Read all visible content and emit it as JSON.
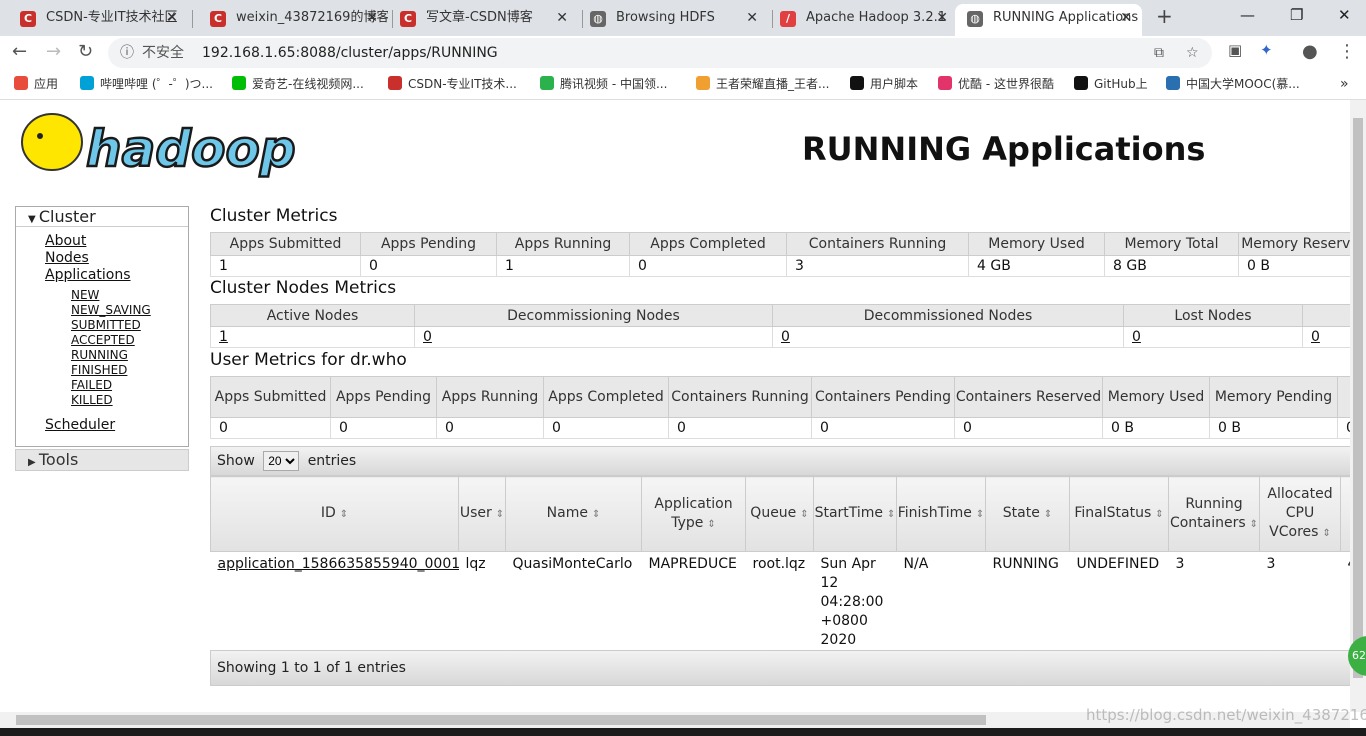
{
  "browser": {
    "tabs": [
      {
        "title": "CSDN-专业IT技术社区",
        "icon": "csdn-icon",
        "color": "#c9302c"
      },
      {
        "title": "weixin_43872169的博客",
        "icon": "csdn-icon",
        "color": "#c9302c"
      },
      {
        "title": "写文章-CSDN博客",
        "icon": "csdn-icon",
        "color": "#c9302c"
      },
      {
        "title": "Browsing HDFS",
        "icon": "globe-icon",
        "color": "#666666"
      },
      {
        "title": "Apache Hadoop 3.2.1",
        "icon": "hadoop-icon",
        "color": "#e04040"
      },
      {
        "title": "RUNNING Applications",
        "icon": "globe-icon",
        "color": "#666666"
      }
    ],
    "insecure_label": "不安全",
    "url": "192.168.1.65:8088/cluster/apps/RUNNING",
    "bookmarks": [
      "应用",
      "哔哩哔哩 (゜-゜)つ...",
      "爱奇艺-在线视频网...",
      "CSDN-专业IT技术...",
      "腾讯视频 - 中国领...",
      "王者荣耀直播_王者...",
      "用户脚本",
      "优酷 - 这世界很酷",
      "GitHub上",
      "中国大学MOOC(慕..."
    ]
  },
  "page": {
    "title": "RUNNING Applications",
    "logo_text": "hadoop",
    "sidebar": {
      "cluster_label": "Cluster",
      "links": [
        "About",
        "Nodes",
        "Applications"
      ],
      "states": [
        "NEW",
        "NEW_SAVING",
        "SUBMITTED",
        "ACCEPTED",
        "RUNNING",
        "FINISHED",
        "FAILED",
        "KILLED"
      ],
      "scheduler": "Scheduler",
      "tools_label": "Tools"
    },
    "cluster_metrics": {
      "title": "Cluster Metrics",
      "headers": [
        "Apps Submitted",
        "Apps Pending",
        "Apps Running",
        "Apps Completed",
        "Containers Running",
        "Memory Used",
        "Memory Total",
        "Memory Reserved"
      ],
      "values": [
        "1",
        "0",
        "1",
        "0",
        "3",
        "4 GB",
        "8 GB",
        "0 B"
      ]
    },
    "cluster_nodes_metrics": {
      "title": "Cluster Nodes Metrics",
      "headers": [
        "Active Nodes",
        "Decommissioning Nodes",
        "Decommissioned Nodes",
        "Lost Nodes",
        ""
      ],
      "values": [
        "1",
        "0",
        "0",
        "0",
        "0"
      ]
    },
    "user_metrics": {
      "title": "User Metrics for dr.who",
      "headers": [
        "Apps Submitted",
        "Apps Pending",
        "Apps Running",
        "Apps Completed",
        "Containers Running",
        "Containers Pending",
        "Containers Reserved",
        "Memory Used",
        "Memory Pending",
        ""
      ],
      "values": [
        "0",
        "0",
        "0",
        "0",
        "0",
        "0",
        "0",
        "0 B",
        "0 B",
        "0"
      ]
    },
    "apps_table": {
      "show_label": "Show",
      "entries_value": "20",
      "entries_label": "entries",
      "headers": [
        "ID",
        "User",
        "Name",
        "Application Type",
        "Queue",
        "StartTime",
        "FinishTime",
        "State",
        "FinalStatus",
        "Running Containers",
        "Allocated CPU VCores",
        ""
      ],
      "rows": [
        [
          "application_1586635855940_0001",
          "lqz",
          "QuasiMonteCarlo",
          "MAPREDUCE",
          "root.lqz",
          "Sun Apr 12 04:28:00 +0800 2020",
          "N/A",
          "RUNNING",
          "UNDEFINED",
          "3",
          "3",
          "4"
        ]
      ],
      "footer": "Showing 1 to 1 of 1 entries"
    }
  },
  "watermark": "https://blog.csdn.net/weixin_43872169",
  "badge": "62"
}
